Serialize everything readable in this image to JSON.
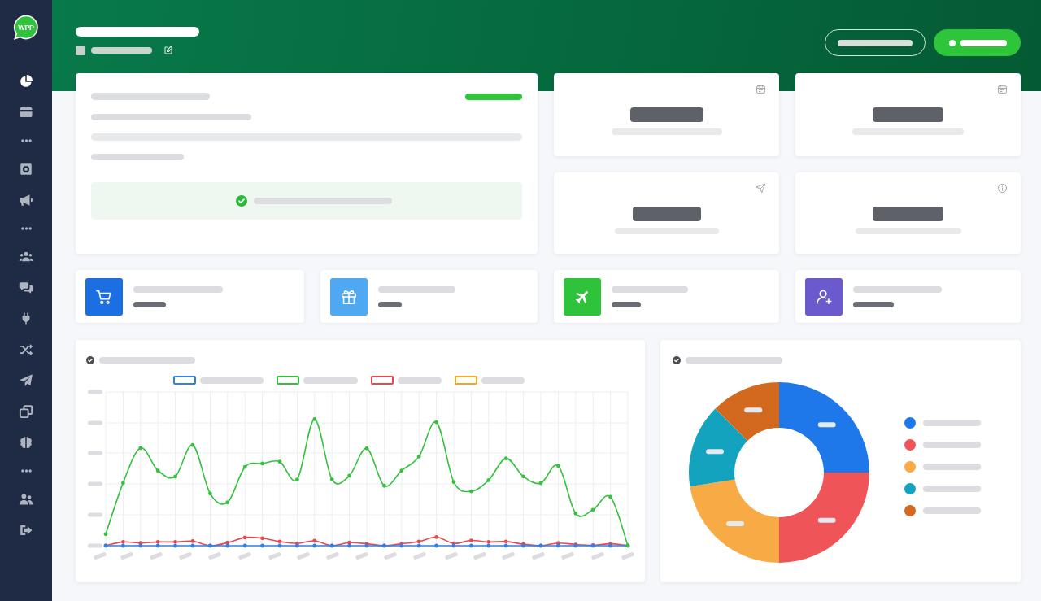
{
  "sidebar": {
    "logo": "WPP",
    "groups": [
      {
        "items": [
          {
            "selected": true
          },
          {
            "selected": false
          }
        ]
      },
      {
        "items": [
          {
            "selected": false
          },
          {
            "selected": false
          }
        ]
      },
      {
        "items": [
          {
            "selected": false
          },
          {
            "selected": false
          },
          {
            "selected": false
          },
          {
            "selected": false
          },
          {
            "selected": false
          },
          {
            "selected": false
          },
          {
            "selected": false
          }
        ]
      },
      {
        "items": [
          {
            "selected": false
          },
          {
            "selected": false
          }
        ]
      }
    ]
  },
  "quick_cards": [
    {
      "color": "#1b6fe3"
    },
    {
      "color": "#4ea8f2"
    },
    {
      "color": "#2fc23b"
    },
    {
      "color": "#6a5acd"
    }
  ],
  "line_chart": {
    "legend": [
      {
        "color": "#2f80ed"
      },
      {
        "color": "#35c13f"
      },
      {
        "color": "#e5484d"
      },
      {
        "color": "#f5a623"
      }
    ]
  },
  "donut_chart": {
    "legend": [
      {
        "color": "#1f78ea"
      },
      {
        "color": "#ef5458"
      },
      {
        "color": "#f8ab45"
      },
      {
        "color": "#14a3bf"
      },
      {
        "color": "#d2691e"
      }
    ]
  }
}
